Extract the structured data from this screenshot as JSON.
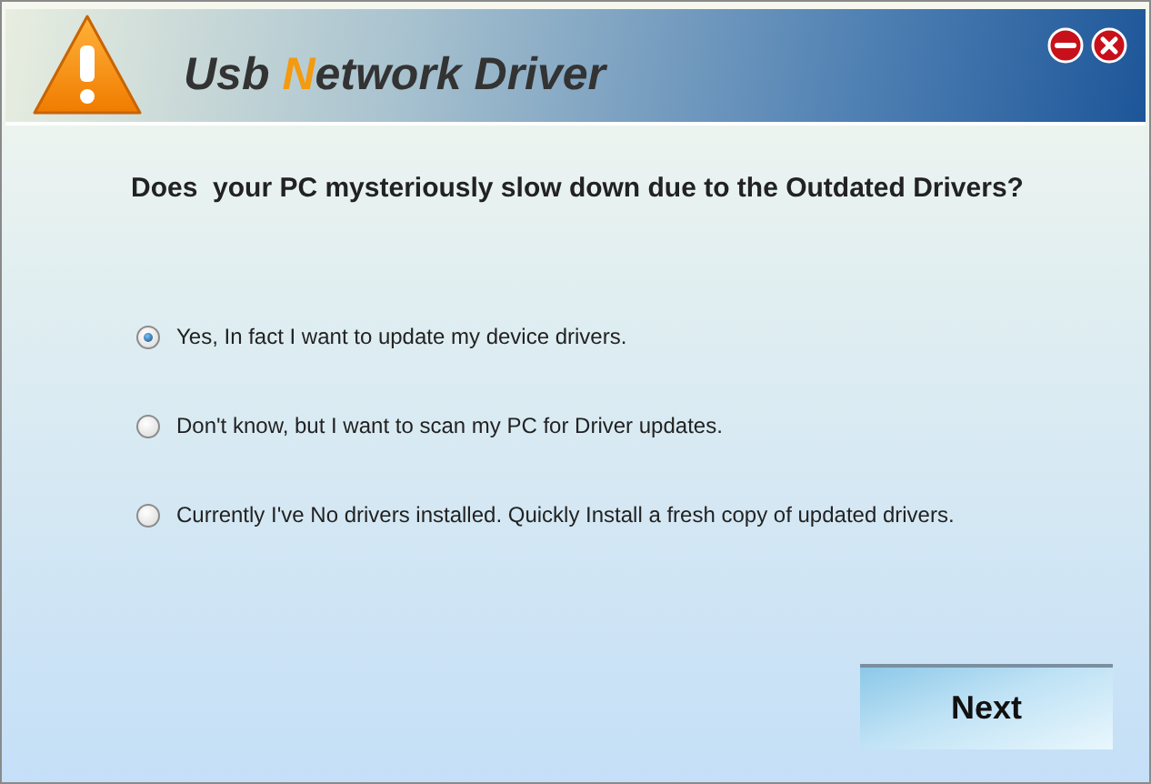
{
  "header": {
    "title_parts": [
      {
        "text": "Usb ",
        "accent": false
      },
      {
        "text": "N",
        "accent": true
      },
      {
        "text": "etwork Driver",
        "accent": false
      }
    ]
  },
  "question": "Does  your PC mysteriously slow down due to the Outdated Drivers?",
  "options": [
    {
      "label": "Yes, In fact I want to update my device drivers.",
      "selected": true
    },
    {
      "label": "Don't know, but I want to scan my PC for Driver updates.",
      "selected": false
    },
    {
      "label": "Currently I've No drivers installed. Quickly Install a fresh copy of updated drivers.",
      "selected": false
    }
  ],
  "next_button": "Next"
}
